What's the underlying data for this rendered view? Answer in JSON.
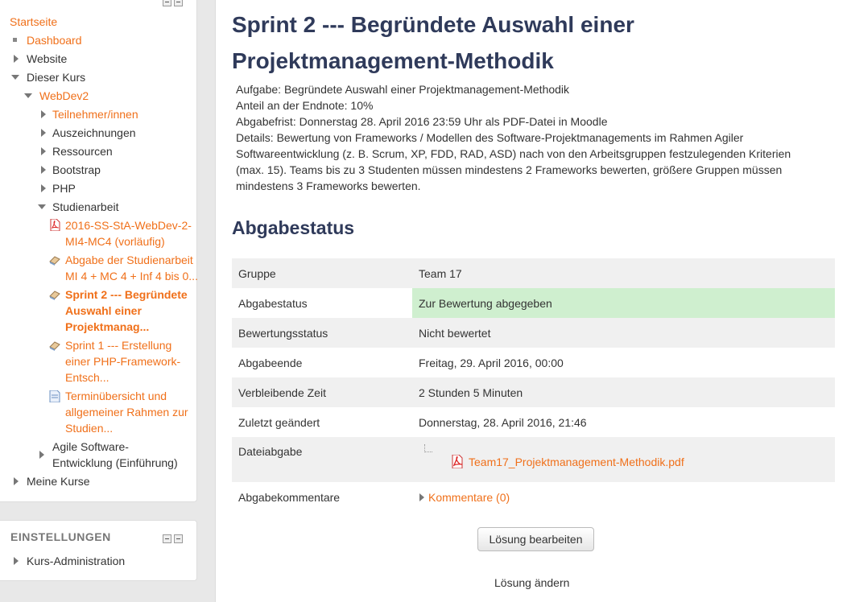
{
  "nav": {
    "startseite": "Startseite",
    "dashboard": "Dashboard",
    "website": "Website",
    "dieser_kurs": "Dieser Kurs",
    "webdev2": "WebDev2",
    "teilnehmer": "Teilnehmer/innen",
    "auszeichnungen": "Auszeichnungen",
    "ressourcen": "Ressourcen",
    "bootstrap": "Bootstrap",
    "php": "PHP",
    "studienarbeit": "Studienarbeit",
    "item1_l1": "2016-SS-StA-WebDev-2-",
    "item1_l2": "MI4-MC4 (vorläufig)",
    "item2_l1": "Abgabe der Studienarbeit",
    "item2_l2": "MI 4 + MC 4 + Inf 4 bis 0...",
    "item3_l1": "Sprint 2 --- Begründete",
    "item3_l2": "Auswahl einer",
    "item3_l3": "Projektmanag...",
    "item4_l1": "Sprint 1 --- Erstellung",
    "item4_l2": "einer PHP-Framework-",
    "item4_l3": "Entsch...",
    "item5_l1": "Terminübersicht und",
    "item5_l2": "allgemeiner Rahmen zur",
    "item5_l3": "Studien...",
    "agile_l1": "Agile Software-",
    "agile_l2": "Entwicklung (Einführung)",
    "meine_kurse": "Meine Kurse"
  },
  "settings": {
    "title": "EINSTELLUNGEN",
    "kurs_admin": "Kurs-Administration"
  },
  "page": {
    "title_l1": "Sprint 2 --- Begründete Auswahl einer",
    "title_l2": "Projektmanagement-Methodik",
    "desc": {
      "aufgabe": "Aufgabe: Begründete Auswahl einer Projektmanagement-Methodik",
      "anteil": "Anteil an der Endnote: 10%",
      "frist": "Abgabefrist: Donnerstag 28. April 2016 23:59 Uhr als PDF-Datei in Moodle",
      "details_l1": "Details: Bewertung von Frameworks / Modellen des Software-Projektmanagements im Rahmen Agiler",
      "details_l2": "Softwareentwicklung (z. B. Scrum, XP, FDD, RAD, ASD) nach von den Arbeitsgruppen festzulegenden Kriterien",
      "details_l3": "(max. 15). Teams bis zu 3 Studenten müssen mindestens 2 Frameworks bewerten, größere Gruppen müssen",
      "details_l4": "mindestens 3 Frameworks bewerten."
    },
    "status_heading": "Abgabestatus",
    "status_rows": {
      "gruppe_k": "Gruppe",
      "gruppe_v": "Team 17",
      "abgabestatus_k": "Abgabestatus",
      "abgabestatus_v": "Zur Bewertung abgegeben",
      "bewertung_k": "Bewertungsstatus",
      "bewertung_v": "Nicht bewertet",
      "ende_k": "Abgabeende",
      "ende_v": "Freitag, 29. April 2016, 00:00",
      "zeit_k": "Verbleibende Zeit",
      "zeit_v": "2 Stunden 5 Minuten",
      "geaendert_k": "Zuletzt geändert",
      "geaendert_v": "Donnerstag, 28. April 2016, 21:46",
      "datei_k": "Dateiabgabe",
      "datei_v": "Team17_Projektmanagement-Methodik.pdf",
      "kommentare_k": "Abgabekommentare",
      "kommentare_v": "Kommentare (0)"
    },
    "edit_button": "Lösung bearbeiten",
    "change_text": "Lösung ändern"
  },
  "colors": {
    "accent": "#f0701a",
    "title": "#2f3a5a",
    "submitted_bg": "#cfefcf"
  }
}
